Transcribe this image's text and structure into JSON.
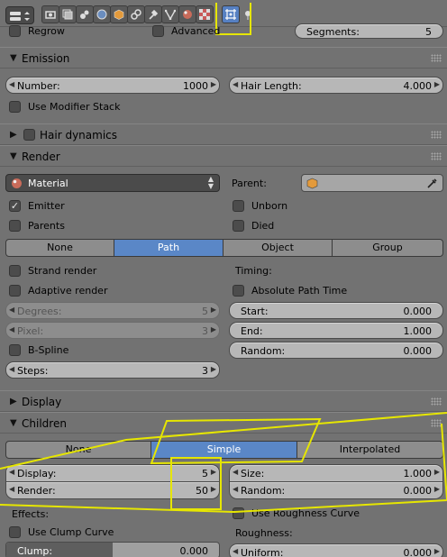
{
  "top_row": {
    "regrow_label": "Regrow",
    "advanced_label": "Advanced",
    "segments_label": "Segments:",
    "segments_value": "5"
  },
  "emission": {
    "title": "Emission",
    "number_label": "Number:",
    "number_value": "1000",
    "hair_length_label": "Hair Length:",
    "hair_length_value": "4.000",
    "use_modifier_stack_label": "Use Modifier Stack"
  },
  "hair_dynamics": {
    "title": "Hair dynamics"
  },
  "render": {
    "title": "Render",
    "material_label": "Material",
    "parent_label": "Parent:",
    "emitter_label": "Emitter",
    "emitter_checked": true,
    "unborn_label": "Unborn",
    "parents_label": "Parents",
    "died_label": "Died",
    "render_as": [
      "None",
      "Path",
      "Object",
      "Group"
    ],
    "render_as_selected": "Path",
    "strand_render_label": "Strand render",
    "timing_label": "Timing:",
    "adaptive_render_label": "Adaptive render",
    "absolute_path_time_label": "Absolute Path Time",
    "degrees_label": "Degrees:",
    "degrees_value": "5",
    "start_label": "Start:",
    "start_value": "0.000",
    "pixel_label": "Pixel:",
    "pixel_value": "3",
    "end_label": "End:",
    "end_value": "1.000",
    "bspline_label": "B-Spline",
    "random_label": "Random:",
    "random_value": "0.000",
    "steps_label": "Steps:",
    "steps_value": "3"
  },
  "display": {
    "title": "Display"
  },
  "children": {
    "title": "Children",
    "modes": [
      "None",
      "Simple",
      "Interpolated"
    ],
    "mode_selected": "Simple",
    "display_label": "Display:",
    "display_value": "5",
    "size_label": "Size:",
    "size_value": "1.000",
    "render_label": "Render:",
    "render_value": "50",
    "random_label": "Random:",
    "random_value": "0.000",
    "effects_label": "Effects:",
    "use_roughness_curve_label": "Use Roughness Curve",
    "use_clump_curve_label": "Use Clump Curve",
    "roughness_label": "Roughness:",
    "clump_label": "Clump:",
    "clump_value": "0.000",
    "clump_fraction": 0.5,
    "uniform_label": "Uniform:",
    "uniform_value": "0.000"
  },
  "colors": {
    "panel_bg": "#727272",
    "active_blue": "#5a87c7",
    "annotation": "#e6e600"
  },
  "icons": [
    "editor-type-icon",
    "render-icon",
    "render-layers-icon",
    "scene-icon",
    "world-icon",
    "object-icon",
    "constraints-icon",
    "modifiers-icon",
    "data-icon",
    "material-icon",
    "texture-icon",
    "particles-icon",
    "physics-icon",
    "material-sphere-icon",
    "cube-icon",
    "eyedropper-icon"
  ]
}
